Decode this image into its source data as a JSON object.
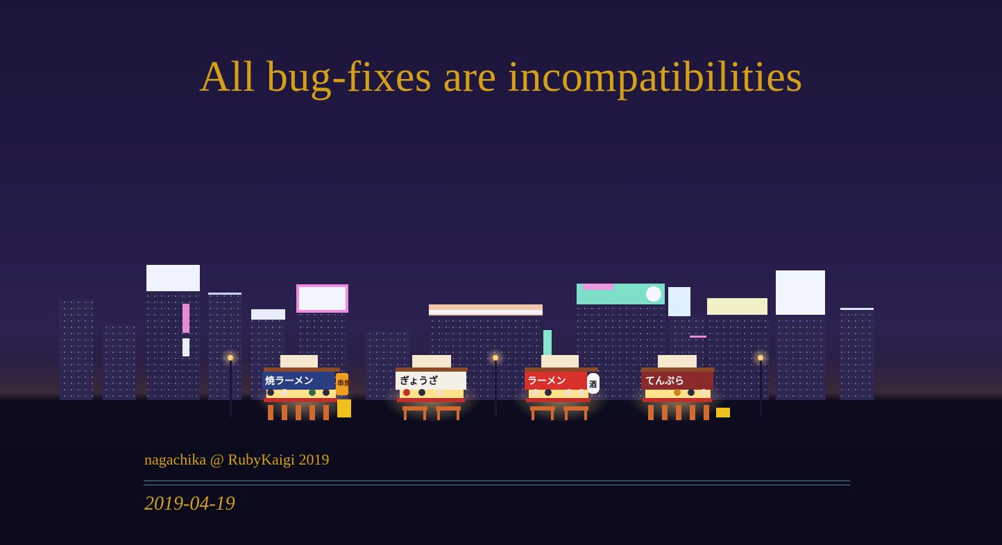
{
  "slide": {
    "title": "All bug-fixes are incompatibilities",
    "author": "nagachika @ RubyKaigi 2019",
    "date": "2019-04-19"
  },
  "stalls": [
    {
      "sign": "焼ラーメン",
      "side_sign": "串焼"
    },
    {
      "sign": "ぎょうざ"
    },
    {
      "sign": "ラーメン",
      "side_sign": "酒"
    },
    {
      "sign": "てんぷら"
    }
  ],
  "colors": {
    "title": "#d4a017",
    "rule": "#4f8a9a",
    "sky_top": "#1c1538",
    "ground": "#0a0a1c"
  }
}
